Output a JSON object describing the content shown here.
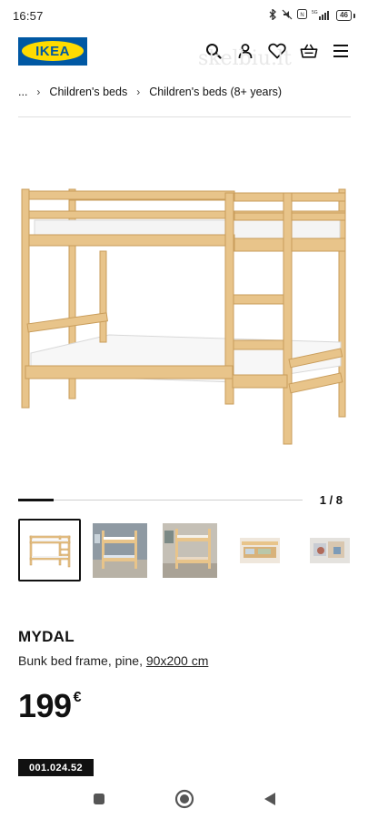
{
  "status_bar": {
    "time": "16:57",
    "battery": "46"
  },
  "header": {
    "logo_text": "IKEA",
    "icons": [
      "search-icon",
      "profile-icon",
      "wishlist-heart-icon",
      "shopping-bag-icon",
      "menu-icon"
    ]
  },
  "watermark": "skelbiu.lt",
  "breadcrumb": {
    "ellipsis": "...",
    "items": [
      "Children's beds",
      "Children's beds (8+ years)"
    ]
  },
  "gallery": {
    "counter": "1 / 8",
    "current": 1,
    "total": 8
  },
  "thumbnails": [
    "thumbnail-1",
    "thumbnail-2",
    "thumbnail-3",
    "thumbnail-4",
    "thumbnail-5"
  ],
  "product": {
    "name": "MYDAL",
    "description": "Bunk bed frame, pine, ",
    "size": "90x200 cm",
    "price": "199",
    "currency": "€",
    "article_number": "001.024.52"
  },
  "colors": {
    "brand_blue": "#0058a3",
    "brand_yellow": "#ffdb00",
    "pine": "#e8c48a"
  },
  "nav_bar": {
    "buttons": [
      "recent-apps-button",
      "home-button",
      "back-button"
    ]
  }
}
